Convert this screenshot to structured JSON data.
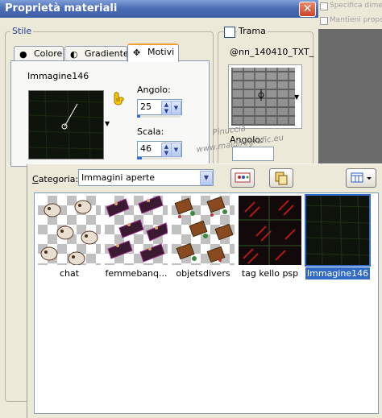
{
  "window": {
    "title": "Proprietà materiali",
    "close_label": "✕"
  },
  "side": {
    "opt1": "Specifica dimensi",
    "opt2": "Mantieni proporzi"
  },
  "stile": {
    "group_label": "Stile",
    "tabs": [
      {
        "label": "Colore",
        "icon": "●"
      },
      {
        "label": "Gradiente",
        "icon": "◐"
      },
      {
        "label": "Motivi",
        "icon": "✥"
      }
    ],
    "image_name": "Immagine146",
    "angolo_label": "Angolo:",
    "angolo_value": "25",
    "angolo_level": 0.07,
    "scala_label": "Scala:",
    "scala_value": "46",
    "scala_level": 0.12
  },
  "trama": {
    "label": "Trama",
    "checked": false,
    "texture_name": "@nn_140410_TXT_",
    "angolo_label": "Angolo:"
  },
  "watermark": {
    "line1": "Pinuccia",
    "line2": "www.maidiregrafic.eu"
  },
  "picker": {
    "categoria_label_u": "C",
    "categoria_label_rest": "ategoria:",
    "categoria_value": "Immagini aperte",
    "items": [
      {
        "label": "chat",
        "selected": false
      },
      {
        "label": "femmebanq...",
        "selected": false
      },
      {
        "label": "objetsdivers",
        "selected": false
      },
      {
        "label": "tag kello psp",
        "selected": false
      },
      {
        "label": "Immagine146",
        "selected": true
      }
    ]
  },
  "colors": {
    "selection": "#316ac5",
    "title_blue": "#3b5ca5",
    "tab_accent": "#f0a030"
  }
}
